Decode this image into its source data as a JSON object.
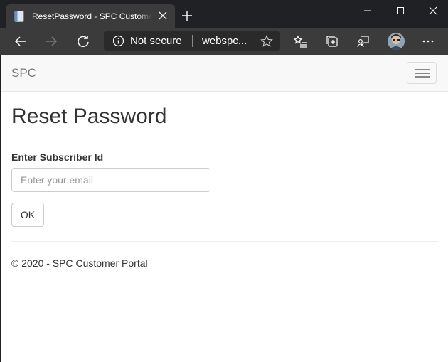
{
  "browser": {
    "tab_title": "ResetPassword - SPC Customer Portal",
    "security_label": "Not secure",
    "url_display": "webspc...",
    "icons": {
      "favicon": "document-icon",
      "tab_close": "close-icon",
      "new_tab": "plus-icon",
      "minimize": "minimize-icon",
      "maximize": "maximize-icon",
      "window_close": "close-icon",
      "back": "back-arrow-icon",
      "forward": "forward-arrow-icon",
      "refresh": "refresh-icon",
      "info": "info-icon",
      "favorite": "star-icon",
      "favorites": "favorites-list-icon",
      "collections": "collections-icon",
      "feedback": "feedback-icon",
      "profile": "avatar",
      "more": "more-icon"
    }
  },
  "navbar": {
    "brand": "SPC",
    "toggle_icon": "hamburger-icon"
  },
  "main": {
    "title": "Reset Password",
    "field_label": "Enter Subscriber Id",
    "field_placeholder": "Enter your email",
    "field_value": "",
    "ok_label": "OK"
  },
  "footer": {
    "text": "© 2020 - SPC Customer Portal"
  },
  "colors": {
    "title_bar": "#202124",
    "toolbar": "#3b3b3b",
    "navbar_bg": "#f8f8f8",
    "text": "#333333",
    "brand_text": "#777777"
  }
}
